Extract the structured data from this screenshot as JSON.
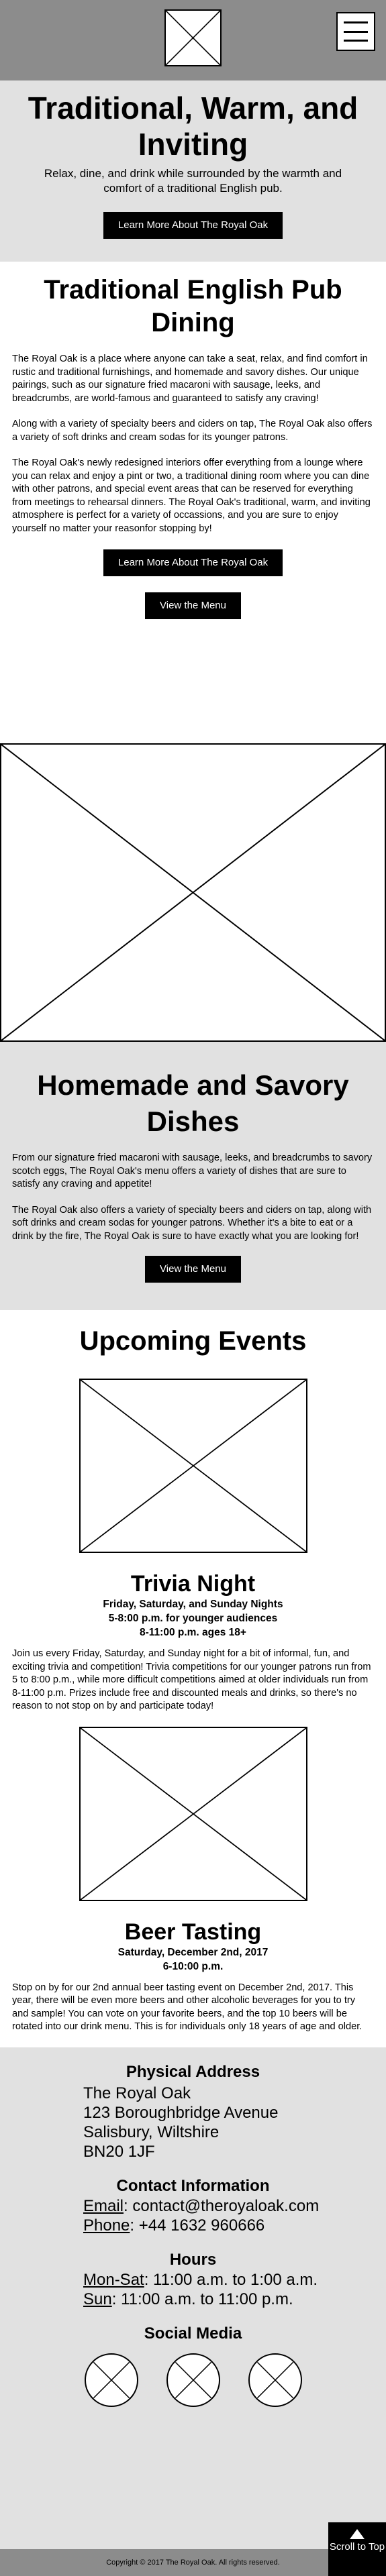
{
  "header": {
    "logo_icon": "placeholder-image-icon",
    "menu_icon": "hamburger-menu-icon",
    "background": "#8c8c8c"
  },
  "hero": {
    "title": "Traditional, Warm, and Inviting",
    "subtitle": "Relax, dine, and drink while surrounded by the warmth and comfort of a traditional English pub.",
    "button": "Learn More About The Royal Oak"
  },
  "pub_dining": {
    "title": "Traditional English Pub Dining",
    "paragraphs": [
      "The Royal Oak is a place where anyone can take a seat, relax, and find comfort in rustic and traditional furnishings, and homemade and savory dishes. Our unique pairings, such as our signature fried macaroni with sausage, leeks, and breadcrumbs, are world-famous and guaranteed to satisfy any craving!",
      "Along with a variety of specialty beers and ciders on tap, The Royal Oak also offers a variety of soft drinks and cream sodas for its younger patrons.",
      "The Royal Oak's newly redesigned interiors offer everything from a lounge where you can relax and enjoy a pint or two, a traditional dining room where you can dine with other patrons, and special event areas that can be reserved for everything from meetings to rehearsal dinners. The Royal Oak's traditional, warm, and inviting atmosphere is perfect for a variety of occassions, and you are sure to enjoy yourself no matter your reasonfor stopping by!"
    ],
    "button_learn": "Learn More About The Royal Oak",
    "button_menu": "View the Menu"
  },
  "dishes": {
    "title": "Homemade and Savory Dishes",
    "paragraphs": [
      "From our signature fried macaroni with sausage, leeks, and breadcrumbs to savory scotch eggs, The Royal Oak's menu offers a variety of dishes that are sure to satisfy any craving and appetite!",
      "The Royal Oak also offers a variety of specialty beers and ciders on tap, along with soft drinks and cream sodas for younger patrons. Whether it's a bite to eat or a drink by the fire, The Royal Oak is sure to have exactly what you are looking for!"
    ],
    "button": "View the Menu"
  },
  "events": {
    "title": "Upcoming Events",
    "items": [
      {
        "title": "Trivia Night",
        "lines": [
          "Friday, Saturday, and Sunday Nights",
          "5-8:00 p.m. for younger audiences",
          "8-11:00 p.m. ages 18+"
        ],
        "description": "Join us every Friday, Saturday, and Sunday night for a bit of informal, fun, and exciting trivia and competition! Trivia competitions for our younger patrons run from 5 to 8:00 p.m., while more difficult competitions aimed at older individuals run from 8-11:00 p.m. Prizes include free and discounted meals and drinks, so there's no reason to not stop on by and participate today!"
      },
      {
        "title": "Beer Tasting",
        "lines": [
          "Saturday, December 2nd, 2017",
          "6-10:00 p.m."
        ],
        "description": "Stop on by for our 2nd annual beer tasting event on December 2nd, 2017. This year, there will be even more beers and other alcoholic beverages for you to try and sample! You can vote on your favorite beers, and the top 10 beers will be rotated into our drink menu. This is for individuals only 18 years of age and older."
      }
    ]
  },
  "footer": {
    "address_title": "Physical Address",
    "address_lines": [
      "The Royal Oak",
      "123 Boroughbridge Avenue",
      "Salisbury, Wiltshire",
      "BN20 1JF"
    ],
    "contact_title": "Contact Information",
    "email_label": "Email",
    "email_value": ": contact@theroyaloak.com",
    "phone_label": "Phone",
    "phone_value": ": +44 1632 960666",
    "hours_title": "Hours",
    "hours": [
      {
        "days": "Mon-Sat",
        "time": ": 11:00 a.m. to 1:00 a.m."
      },
      {
        "days": "Sun",
        "time": ": 11:00 a.m. to 11:00 p.m."
      }
    ],
    "social_title": "Social Media",
    "social_icons": [
      "social-placeholder-icon",
      "social-placeholder-icon",
      "social-placeholder-icon"
    ],
    "copyright": "Copyright © 2017 The Royal Oak. All rights reserved.",
    "scroll_top": "Scroll to Top"
  }
}
